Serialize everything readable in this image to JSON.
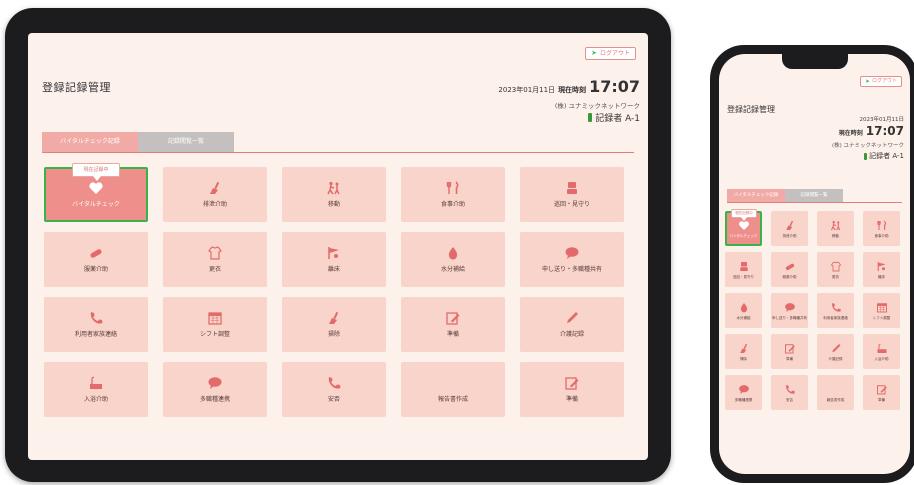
{
  "brand_colors": {
    "accent": "#e37d7a",
    "tile": "#f8d4cb",
    "tile_selected": "#ef8f8c",
    "selected_border": "#37b34a",
    "tab_active": "#f2aaa7",
    "tab_inactive": "#c5c0c0"
  },
  "tablet": {
    "logout": "ログアウト",
    "title": "登録記録管理",
    "date": "2023年01月11日",
    "now_label": "現在時刻",
    "time": "17:07",
    "company": "(株) ユナミックネットワーク",
    "recorder": "記録者 A-1",
    "tabs": [
      "バイタルチェック記録",
      "記録閲覧一覧"
    ],
    "bubble": "現在記録中",
    "tiles": [
      {
        "label": "バイタルチェック",
        "icon": "heart-pulse-icon"
      },
      {
        "label": "排泄介助",
        "icon": "broom-icon"
      },
      {
        "label": "移動",
        "icon": "walking-assist-icon"
      },
      {
        "label": "食事介助",
        "icon": "cutlery-icon"
      },
      {
        "label": "巡回・見守り",
        "icon": "person-icon"
      },
      {
        "label": "服薬介助",
        "icon": "pill-icon"
      },
      {
        "label": "更衣",
        "icon": "clothes-icon"
      },
      {
        "label": "離床",
        "icon": "flag-icon"
      },
      {
        "label": "水分補給",
        "icon": "water-drop-icon"
      },
      {
        "label": "申し送り・多職種共有",
        "icon": "chat-icon"
      },
      {
        "label": "利用者家族連絡",
        "icon": "phone-icon"
      },
      {
        "label": "シフト調整",
        "icon": "calendar-icon"
      },
      {
        "label": "掃除",
        "icon": "broom-icon"
      },
      {
        "label": "準備",
        "icon": "edit-icon"
      },
      {
        "label": "介護記録",
        "icon": "pencil-icon"
      },
      {
        "label": "入浴介助",
        "icon": "bath-icon"
      },
      {
        "label": "多職種連携",
        "icon": "chat-icon"
      },
      {
        "label": "安否",
        "icon": "phone-icon"
      },
      {
        "label": "報告書作成",
        "icon": ""
      },
      {
        "label": "準備",
        "icon": "edit-icon"
      }
    ]
  },
  "phone": {
    "logout": "ログアウト",
    "title": "登録記録管理",
    "date": "2023年01月11日",
    "now_label": "現在時刻",
    "time": "17:07",
    "company": "(株) ユナミックネットワーク",
    "recorder": "記録者 A-1",
    "tabs": [
      "バイタルチェック記録",
      "記録閲覧一覧"
    ],
    "bubble": "現在記録中",
    "tiles": [
      {
        "label": "バイタルチェック",
        "icon": "heart-pulse-icon"
      },
      {
        "label": "排泄介助",
        "icon": "broom-icon"
      },
      {
        "label": "移動",
        "icon": "walking-assist-icon"
      },
      {
        "label": "食事介助",
        "icon": "cutlery-icon"
      },
      {
        "label": "巡回・見守り",
        "icon": "person-icon"
      },
      {
        "label": "服薬介助",
        "icon": "pill-icon"
      },
      {
        "label": "更衣",
        "icon": "clothes-icon"
      },
      {
        "label": "離床",
        "icon": "flag-icon"
      },
      {
        "label": "水分補給",
        "icon": "water-drop-icon"
      },
      {
        "label": "申し送り・多職種共有",
        "icon": "chat-icon"
      },
      {
        "label": "利用者家族連絡",
        "icon": "phone-icon"
      },
      {
        "label": "シフト調整",
        "icon": "calendar-icon"
      },
      {
        "label": "掃除",
        "icon": "broom-icon"
      },
      {
        "label": "準備",
        "icon": "edit-icon"
      },
      {
        "label": "介護記録",
        "icon": "pencil-icon"
      },
      {
        "label": "入浴介助",
        "icon": "bath-icon"
      },
      {
        "label": "多職種連携",
        "icon": "chat-icon"
      },
      {
        "label": "安否",
        "icon": "phone-icon"
      },
      {
        "label": "報告書作成",
        "icon": ""
      },
      {
        "label": "準備",
        "icon": "edit-icon"
      }
    ]
  }
}
